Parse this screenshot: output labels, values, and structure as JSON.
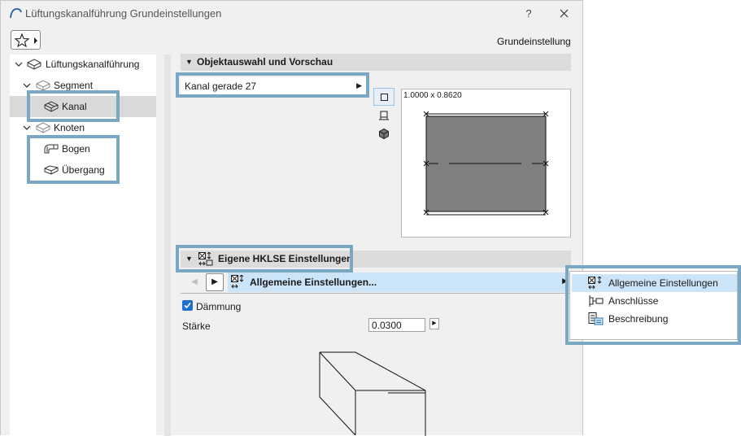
{
  "window": {
    "title": "Lüftungskanalführung Grundeinstellungen",
    "help": "?",
    "preset_label": "Grundeinstellung"
  },
  "tree": [
    {
      "label": "Lüftungskanalführung",
      "icon": "duct-route-icon"
    },
    {
      "label": "Segment",
      "icon": "segment-icon"
    },
    {
      "label": "Kanal",
      "icon": "duct-icon",
      "selected": true
    },
    {
      "label": "Knoten",
      "icon": "node-icon"
    },
    {
      "label": "Bogen",
      "icon": "bend-icon"
    },
    {
      "label": "Übergang",
      "icon": "transition-icon"
    }
  ],
  "object_section": {
    "title": "Objektauswahl und Vorschau",
    "selected_object": "Kanal gerade 27",
    "preview_dimension": "1.0000 x 0.8620",
    "view_buttons": [
      "plan-view-icon",
      "section-view-icon",
      "3d-view-icon"
    ]
  },
  "hklse_section": {
    "title": "Eigene HKLSE Einstellungen",
    "current_page": "Allgemeine Einstellungen...",
    "insulation_label": "Dämmung",
    "insulation_checked": true,
    "thickness_label": "Stärke",
    "thickness_value": "0.0300"
  },
  "popup_menu": {
    "items": [
      {
        "label": "Allgemeine Einstellungen",
        "icon": "general-settings-icon",
        "selected": true
      },
      {
        "label": "Anschlüsse",
        "icon": "connections-icon"
      },
      {
        "label": "Beschreibung",
        "icon": "description-icon"
      }
    ]
  },
  "colors": {
    "highlight_frame": "#7aa7c4",
    "selection": "#cce4f7",
    "checkbox": "#1e6fd0",
    "preview_fill": "#808080"
  }
}
